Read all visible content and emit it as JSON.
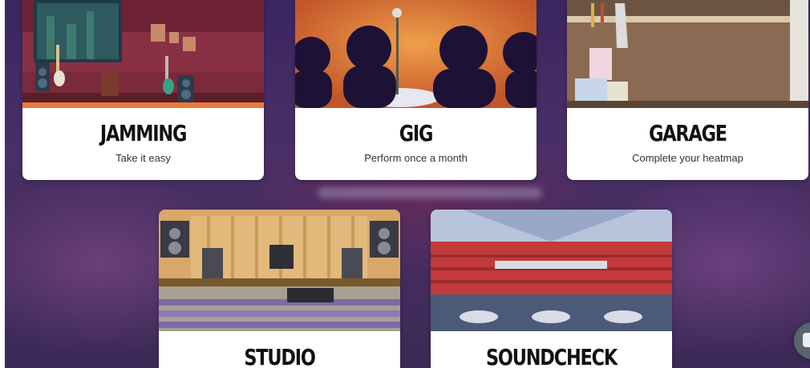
{
  "cards": [
    {
      "id": "jamming",
      "title": "JAMMING",
      "subtitle": "Take it easy",
      "scene": "rehearsal-room-illustration"
    },
    {
      "id": "gig",
      "title": "GIG",
      "subtitle": "Perform once a month",
      "scene": "audience-silhouette-illustration"
    },
    {
      "id": "garage",
      "title": "GARAGE",
      "subtitle": "Complete your heatmap",
      "scene": "garage-tools-illustration"
    },
    {
      "id": "studio",
      "title": "STUDIO",
      "subtitle": "",
      "scene": "recording-studio-illustration"
    },
    {
      "id": "soundcheck",
      "title": "SOUNDCHECK",
      "subtitle": "",
      "scene": "arena-illustration"
    }
  ],
  "chat": {
    "icon": "chat-icon"
  },
  "colors": {
    "background": "#3b2660",
    "card": "#ffffff",
    "title_text": "#111111",
    "subtitle_text": "#333333"
  }
}
